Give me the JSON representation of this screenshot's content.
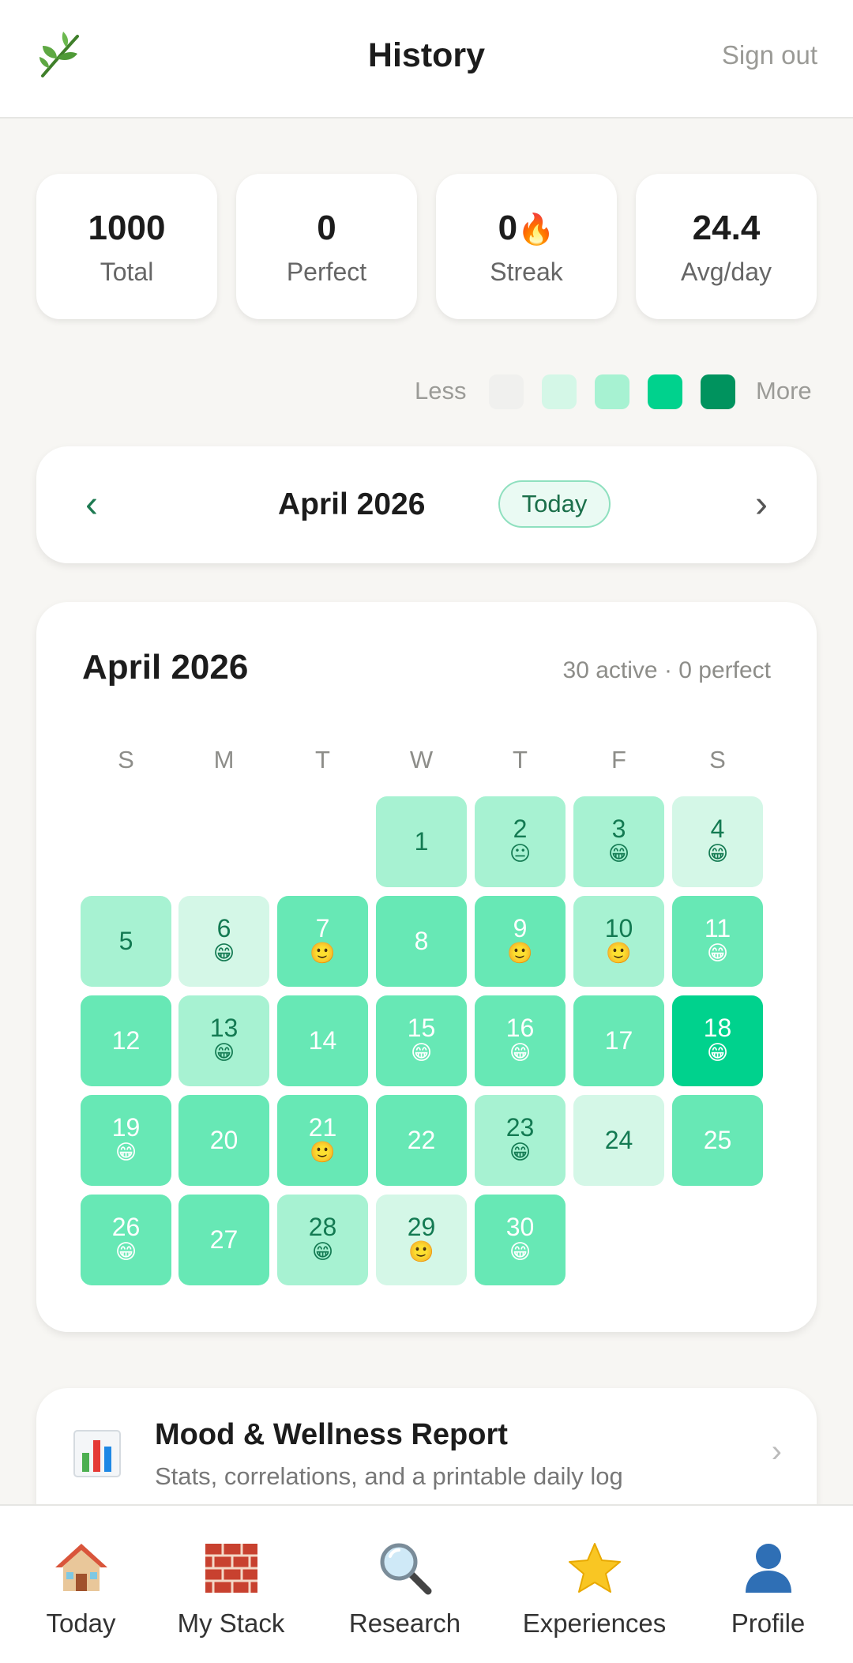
{
  "header": {
    "title": "History",
    "sign_out": "Sign out"
  },
  "stats": [
    {
      "value": "1000",
      "label": "Total"
    },
    {
      "value": "0",
      "label": "Perfect"
    },
    {
      "value": "0",
      "label": "Streak",
      "suffix": "🔥"
    },
    {
      "value": "24.4",
      "label": "Avg/day"
    }
  ],
  "legend": {
    "less": "Less",
    "more": "More",
    "colors": [
      "#f0f0ee",
      "#d4f7e7",
      "#a7f2d2",
      "#00d28d",
      "#00935e"
    ]
  },
  "month_nav": {
    "prev_icon": "‹",
    "month": "April 2026",
    "today": "Today",
    "next_icon": "›"
  },
  "calendar": {
    "title": "April 2026",
    "summary": "30 active · 0 perfect",
    "weekdays": [
      "S",
      "M",
      "T",
      "W",
      "T",
      "F",
      "S"
    ],
    "days": [
      {
        "n": "1",
        "lvl": 2,
        "e": ""
      },
      {
        "n": "2",
        "lvl": 2,
        "e": "😐"
      },
      {
        "n": "3",
        "lvl": 2,
        "e": "😁"
      },
      {
        "n": "4",
        "lvl": 1,
        "e": "😁"
      },
      {
        "n": "5",
        "lvl": 2,
        "e": ""
      },
      {
        "n": "6",
        "lvl": 1,
        "e": "😁"
      },
      {
        "n": "7",
        "lvl": 3,
        "e": "🙂"
      },
      {
        "n": "8",
        "lvl": 3,
        "e": ""
      },
      {
        "n": "9",
        "lvl": 3,
        "e": "🙂"
      },
      {
        "n": "10",
        "lvl": 2,
        "e": "🙂"
      },
      {
        "n": "11",
        "lvl": 3,
        "e": "😁"
      },
      {
        "n": "12",
        "lvl": 3,
        "e": ""
      },
      {
        "n": "13",
        "lvl": 2,
        "e": "😁"
      },
      {
        "n": "14",
        "lvl": 3,
        "e": ""
      },
      {
        "n": "15",
        "lvl": 3,
        "e": "😁"
      },
      {
        "n": "16",
        "lvl": 3,
        "e": "😁"
      },
      {
        "n": "17",
        "lvl": 3,
        "e": ""
      },
      {
        "n": "18",
        "lvl": 4,
        "e": "😁"
      },
      {
        "n": "19",
        "lvl": 3,
        "e": "😁"
      },
      {
        "n": "20",
        "lvl": 3,
        "e": ""
      },
      {
        "n": "21",
        "lvl": 3,
        "e": "🙂"
      },
      {
        "n": "22",
        "lvl": 3,
        "e": ""
      },
      {
        "n": "23",
        "lvl": 2,
        "e": "😁"
      },
      {
        "n": "24",
        "lvl": 1,
        "e": ""
      },
      {
        "n": "25",
        "lvl": 3,
        "e": ""
      },
      {
        "n": "26",
        "lvl": 3,
        "e": "😁"
      },
      {
        "n": "27",
        "lvl": 3,
        "e": ""
      },
      {
        "n": "28",
        "lvl": 2,
        "e": "😁"
      },
      {
        "n": "29",
        "lvl": 1,
        "e": "🙂"
      },
      {
        "n": "30",
        "lvl": 3,
        "e": "😁"
      }
    ]
  },
  "report": {
    "title": "Mood & Wellness Report",
    "subtitle": "Stats, correlations, and a printable daily log",
    "chevron": "›"
  },
  "bottom_nav": [
    {
      "label": "Today",
      "icon": "house-icon"
    },
    {
      "label": "My Stack",
      "icon": "bricks-icon"
    },
    {
      "label": "Research",
      "icon": "magnifier-icon"
    },
    {
      "label": "Experiences",
      "icon": "star-icon"
    },
    {
      "label": "Profile",
      "icon": "person-icon"
    }
  ]
}
